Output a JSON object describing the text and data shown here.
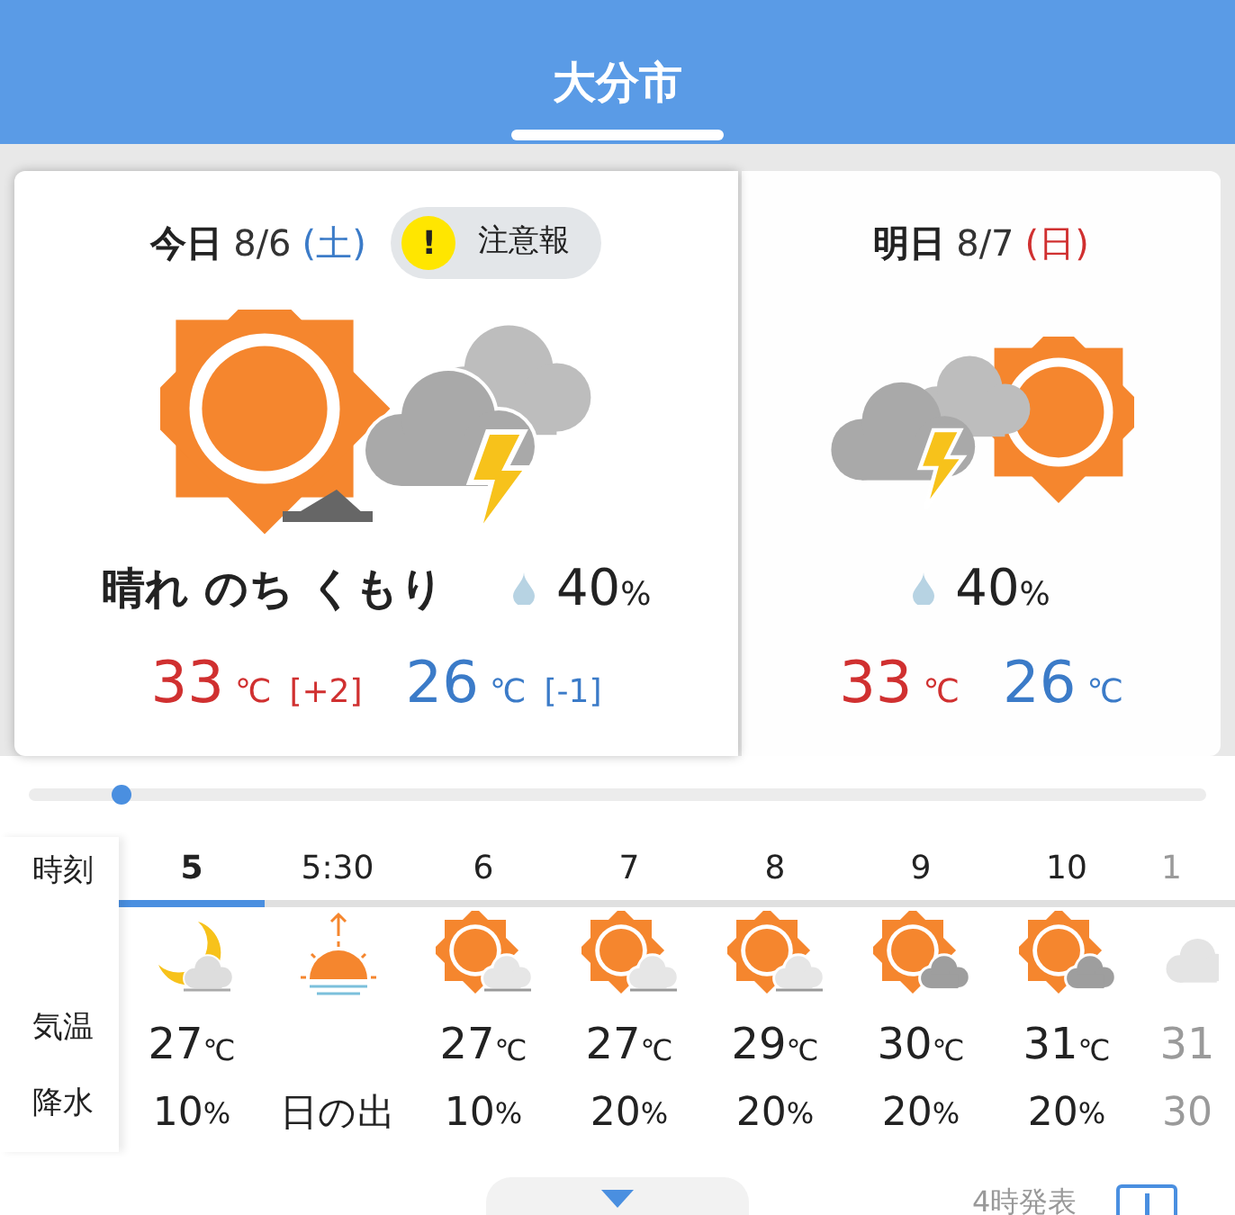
{
  "header": {
    "title": "大分市"
  },
  "days": [
    {
      "label": "今日",
      "date": "8/6",
      "weekday": "(土)",
      "color": "#3b7bc8",
      "selected": true,
      "warning": {
        "mark": "!",
        "text": "注意報"
      },
      "kind": "sun_then_thunder",
      "weather": "晴れ のち くもり",
      "rain": "40",
      "rain_unit": "%",
      "high": "33",
      "low": "26",
      "unit": "℃",
      "high_diff": "[+2]",
      "low_diff": "[-1]"
    },
    {
      "label": "明日",
      "date": "8/7",
      "weekday": "(日)",
      "color": "#d03030",
      "selected": false,
      "kind": "thunder_sun",
      "rain": "40",
      "rain_unit": "%",
      "high": "33",
      "low": "26",
      "unit": "℃"
    }
  ],
  "slider": {
    "level": 0.07
  },
  "table": {
    "labels": [
      "時刻",
      "気温",
      "降水"
    ],
    "unit": "℃",
    "rain_unit": "%",
    "hours": [
      {
        "time": "5",
        "selected": true,
        "faded": false,
        "kind": "moon_cloud",
        "temp": "27",
        "rain": "10"
      },
      {
        "time": "5:30",
        "selected": false,
        "faded": false,
        "kind": "sunrise",
        "event": "日の出"
      },
      {
        "time": "6",
        "selected": false,
        "faded": false,
        "kind": "sun_cloud",
        "temp": "27",
        "rain": "10"
      },
      {
        "time": "7",
        "selected": false,
        "faded": false,
        "kind": "sun_cloud",
        "temp": "27",
        "rain": "20"
      },
      {
        "time": "8",
        "selected": false,
        "faded": false,
        "kind": "sun_cloud",
        "temp": "29",
        "rain": "20"
      },
      {
        "time": "9",
        "selected": false,
        "faded": false,
        "kind": "sun_darkcloud",
        "temp": "30",
        "rain": "20"
      },
      {
        "time": "10",
        "selected": false,
        "faded": false,
        "kind": "sun_darkcloud",
        "temp": "31",
        "rain": "20"
      },
      {
        "time": "1",
        "selected": false,
        "faded": true,
        "kind": "cloud",
        "temp": "31",
        "rain": "30"
      }
    ]
  },
  "footer": {
    "announced": "4時発表"
  }
}
